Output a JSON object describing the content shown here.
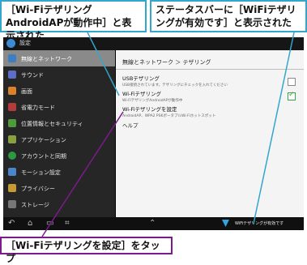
{
  "callouts": {
    "left": "［Wi-FiテザリングAndroidAPが動作中］と表示された",
    "right": "ステータスバーに［WiFiテザリングが有効です］と表示された",
    "bottom": "［Wi-Fiテザリングを設定］をタップ"
  },
  "topbar": {
    "title": "設定"
  },
  "sidebar": {
    "items": [
      {
        "label": "無線とネットワーク",
        "icon": "wifi-icon",
        "color": "#3e7fc1"
      },
      {
        "label": "サウンド",
        "icon": "speaker-icon",
        "color": "#5b6fc6"
      },
      {
        "label": "画面",
        "icon": "display-icon",
        "color": "#d9822b"
      },
      {
        "label": "省電力モード",
        "icon": "battery-icon",
        "color": "#b33b3b"
      },
      {
        "label": "位置情報とセキュリティ",
        "icon": "lock-icon",
        "color": "#4f9a3a"
      },
      {
        "label": "アプリケーション",
        "icon": "apps-icon",
        "color": "#8aa040"
      },
      {
        "label": "アカウントと同期",
        "icon": "sync-icon",
        "color": "#2c9a45"
      },
      {
        "label": "モーション設定",
        "icon": "motion-icon",
        "color": "#4b86c8"
      },
      {
        "label": "プライバシー",
        "icon": "privacy-icon",
        "color": "#c99b35"
      },
      {
        "label": "ストレージ",
        "icon": "storage-icon",
        "color": "#777777"
      }
    ]
  },
  "panel": {
    "breadcrumb": "無線とネットワーク  ＞  テザリング",
    "usb": {
      "title": "USBテザリング",
      "sub": "USB接続されています。テザリングにチェックを入れてください"
    },
    "wifi": {
      "title": "Wi-Fiテザリング",
      "sub": "Wi-FiテザリングAndroidAPが動作中"
    },
    "wifi_settings": {
      "title": "Wi-Fiテザリングを設定",
      "sub": "AndroidAP、WPA2 PSKポータブルWi-Fiホットスポット"
    },
    "help": "ヘルプ"
  },
  "statusbar": {
    "text": "WiFiテザリングが有効です"
  },
  "colors": {
    "callout_blue": "#33a6cc",
    "callout_purple": "#7d1a8e"
  }
}
